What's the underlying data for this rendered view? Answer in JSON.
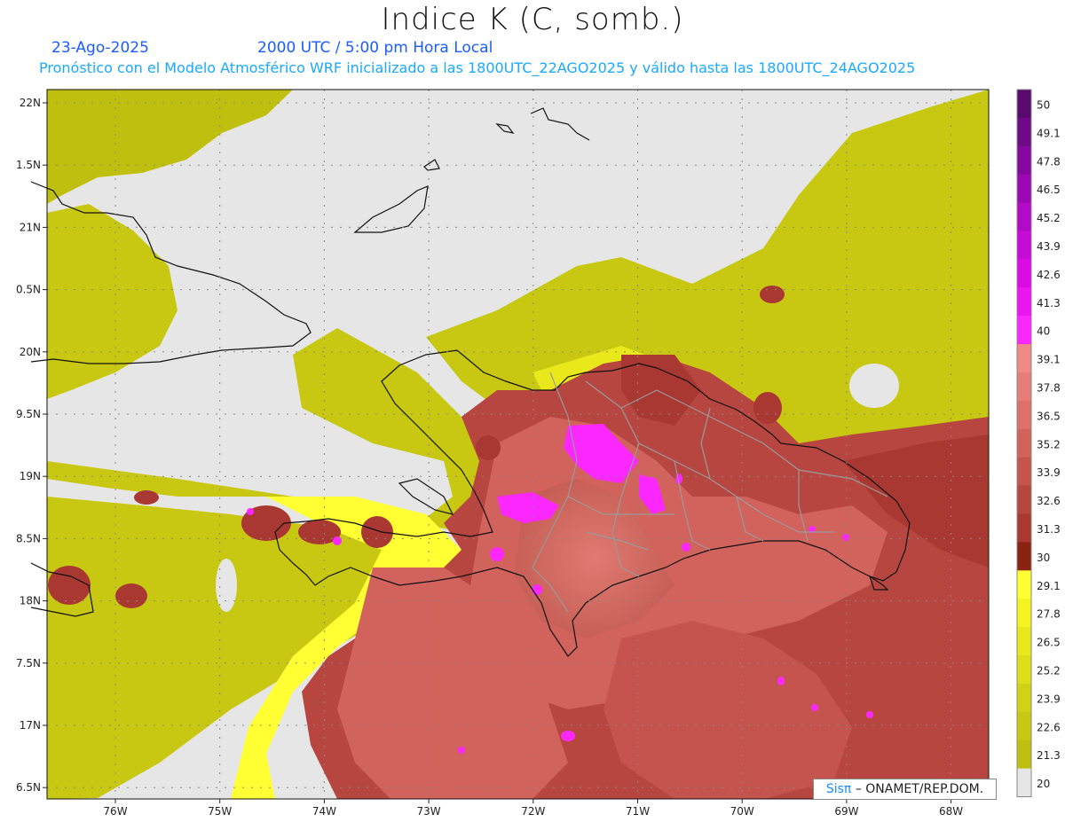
{
  "header": {
    "title": "Indice K (C, somb.)",
    "date": "23-Ago-2025",
    "time": "2000 UTC / 5:00 pm Hora Local",
    "description": "Pronóstico con el Modelo Atmosférico WRF inicializado a las 1800UTC_22AGO2025 y válido hasta las  1800UTC_24AGO2025"
  },
  "map": {
    "lat_labels": [
      "22N",
      "1.5N",
      "21N",
      "0.5N",
      "20N",
      "9.5N",
      "19N",
      "8.5N",
      "18N",
      "7.5N",
      "17N",
      "6.5N"
    ],
    "lon_labels": [
      "76W",
      "75W",
      "74W",
      "73W",
      "72W",
      "71W",
      "70W",
      "69W",
      "68W"
    ]
  },
  "colorbar": {
    "labels": [
      "50",
      "49.1",
      "47.8",
      "46.5",
      "45.2",
      "43.9",
      "42.6",
      "41.3",
      "40",
      "39.1",
      "37.8",
      "36.5",
      "35.2",
      "33.9",
      "32.6",
      "31.3",
      "30",
      "29.1",
      "27.8",
      "26.5",
      "25.2",
      "23.9",
      "22.6",
      "21.3",
      "20"
    ],
    "colors": [
      "#5a0a6e",
      "#6f0a86",
      "#86089e",
      "#9c08b4",
      "#b20ac8",
      "#c70ad8",
      "#db0ae6",
      "#ec14f2",
      "#fa28ff",
      "#f08a86",
      "#e77d78",
      "#dd706a",
      "#d2625c",
      "#c5544e",
      "#b84640",
      "#a93832",
      "#8a2410",
      "#ffff33",
      "#f4f421",
      "#e8e81b",
      "#dede18",
      "#d2d215",
      "#c8c812",
      "#bfbf10",
      "#e6e6e6"
    ]
  },
  "credit": {
    "logo": "Sisπ",
    "text": "– ONAMET/REP.DOM."
  }
}
